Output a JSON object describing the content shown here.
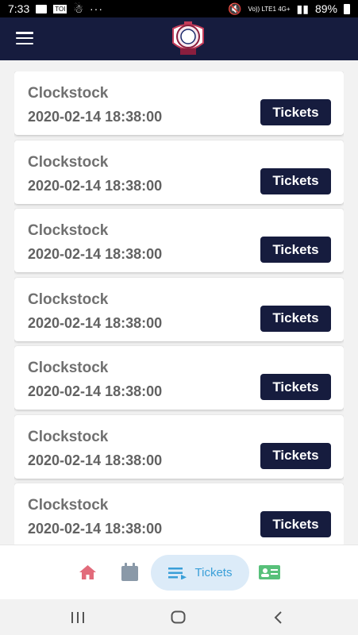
{
  "status_bar": {
    "time": "7:33",
    "notification_badge": "TOI",
    "more": "···",
    "network": "Vo)) LTE1 4G+",
    "battery": "89%"
  },
  "app_bar": {
    "menu_icon": "hamburger-icon",
    "logo_icon": "club-crest-logo"
  },
  "events": [
    {
      "title": "Clockstock",
      "date": "2020-02-14 18:38:00",
      "button_label": "Tickets"
    },
    {
      "title": "Clockstock",
      "date": "2020-02-14 18:38:00",
      "button_label": "Tickets"
    },
    {
      "title": "Clockstock",
      "date": "2020-02-14 18:38:00",
      "button_label": "Tickets"
    },
    {
      "title": "Clockstock",
      "date": "2020-02-14 18:38:00",
      "button_label": "Tickets"
    },
    {
      "title": "Clockstock",
      "date": "2020-02-14 18:38:00",
      "button_label": "Tickets"
    },
    {
      "title": "Clockstock",
      "date": "2020-02-14 18:38:00",
      "button_label": "Tickets"
    },
    {
      "title": "Clockstock",
      "date": "2020-02-14 18:38:00",
      "button_label": "Tickets"
    }
  ],
  "bottom_nav": {
    "items": [
      {
        "icon": "home-icon",
        "color": "#e26b7b"
      },
      {
        "icon": "calendar-icon",
        "color": "#8a99a8"
      },
      {
        "icon": "list-icon",
        "label": "Tickets",
        "color": "#3a9fd8",
        "active": true
      },
      {
        "icon": "id-card-icon",
        "color": "#58c07a"
      }
    ]
  },
  "colors": {
    "primary_navy": "#161c3e",
    "card_bg": "#ffffff",
    "page_bg": "#f2f2f2",
    "active_pill": "#dcebf8"
  }
}
